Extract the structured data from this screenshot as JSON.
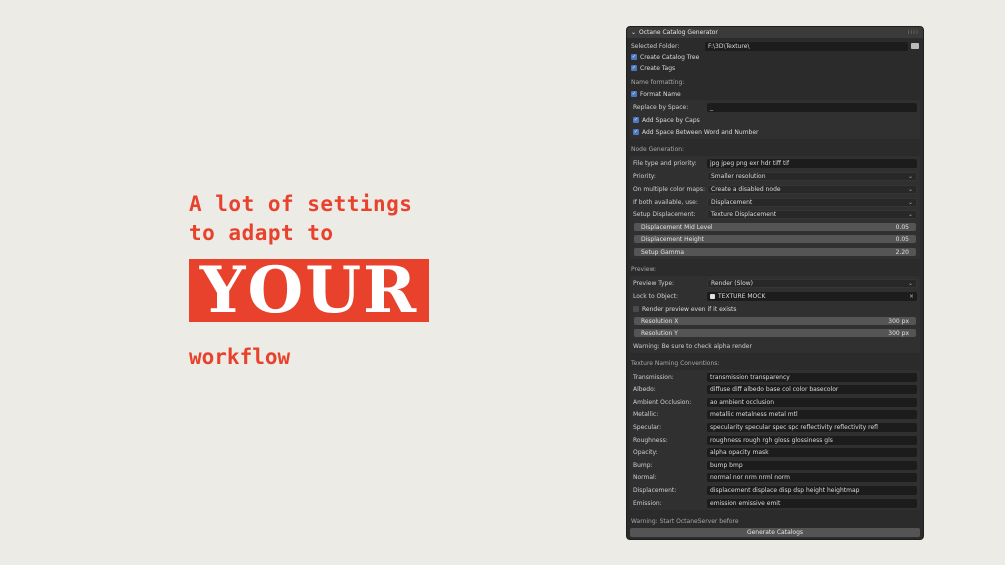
{
  "promo": {
    "line1": "A lot of settings",
    "line2": "to adapt to",
    "highlight": "YOUR",
    "line3": "workflow",
    "accent_color": "#e8412c"
  },
  "panel": {
    "title": "Octane Catalog Generator",
    "collapse_icon": "chevron-down-icon",
    "selected_folder": {
      "label": "Selected Folder:",
      "value": "F:\\3D\\Texture\\"
    },
    "create_catalog_tree": "Create Catalog Tree",
    "create_tags": "Create Tags",
    "name_formatting": {
      "title": "Name formatting:",
      "format_name": "Format Name",
      "replace_by_space": {
        "label": "Replace by Space:",
        "value": "_"
      },
      "add_space_by_caps": "Add Space by Caps",
      "add_space_word_number": "Add Space Between Word and Number"
    },
    "node_generation": {
      "title": "Node Generation:",
      "file_type": {
        "label": "File type and priority:",
        "value": "jpg jpeg png exr hdr tiff tif"
      },
      "priority": {
        "label": "Priority:",
        "value": "Smaller resolution"
      },
      "multiple_maps": {
        "label": "On multiple color maps:",
        "value": "Create a disabled node"
      },
      "both_available": {
        "label": "If both available, use:",
        "value": "Displacement"
      },
      "setup_displacement": {
        "label": "Setup Displacement:",
        "value": "Texture Displacement"
      },
      "mid_level": {
        "label": "Displacement Mid Level",
        "value": "0.05"
      },
      "height": {
        "label": "Displacement Height",
        "value": "0.05"
      },
      "gamma": {
        "label": "Setup Gamma",
        "value": "2.20"
      }
    },
    "preview": {
      "title": "Preview:",
      "preview_type": {
        "label": "Preview Type:",
        "value": "Render (Slow)"
      },
      "lock_to_object": {
        "label": "Lock to Object:",
        "value": "TEXTURE MOCK"
      },
      "render_if_exists": "Render preview even if it exists",
      "res_x": {
        "label": "Resolution X",
        "value": "300 px"
      },
      "res_y": {
        "label": "Resolution Y",
        "value": "300 px"
      },
      "warning": "Warning: Be sure to check alpha render"
    },
    "naming": {
      "title": "Texture Naming Conventions:",
      "rows": [
        {
          "label": "Transmission:",
          "value": "transmission transparency"
        },
        {
          "label": "Albedo:",
          "value": "diffuse diff albedo base col color basecolor"
        },
        {
          "label": "Ambient Occlusion:",
          "value": "ao ambient occlusion"
        },
        {
          "label": "Metallic:",
          "value": "metallic metalness metal mtl"
        },
        {
          "label": "Specular:",
          "value": "specularity specular spec spc reflectivity reflectivity refl"
        },
        {
          "label": "Roughness:",
          "value": "roughness rough rgh gloss glossiness gls"
        },
        {
          "label": "Opacity:",
          "value": "alpha opacity mask"
        },
        {
          "label": "Bump:",
          "value": "bump bmp"
        },
        {
          "label": "Normal:",
          "value": "normal nor nrm nrml norm"
        },
        {
          "label": "Displacement:",
          "value": "displacement displace disp dsp height heightmap"
        },
        {
          "label": "Emission:",
          "value": "emission emissive emit"
        }
      ]
    },
    "bottom_warning": "Warning: Start OctaneServer before",
    "generate_button": "Generate Catalogs"
  }
}
